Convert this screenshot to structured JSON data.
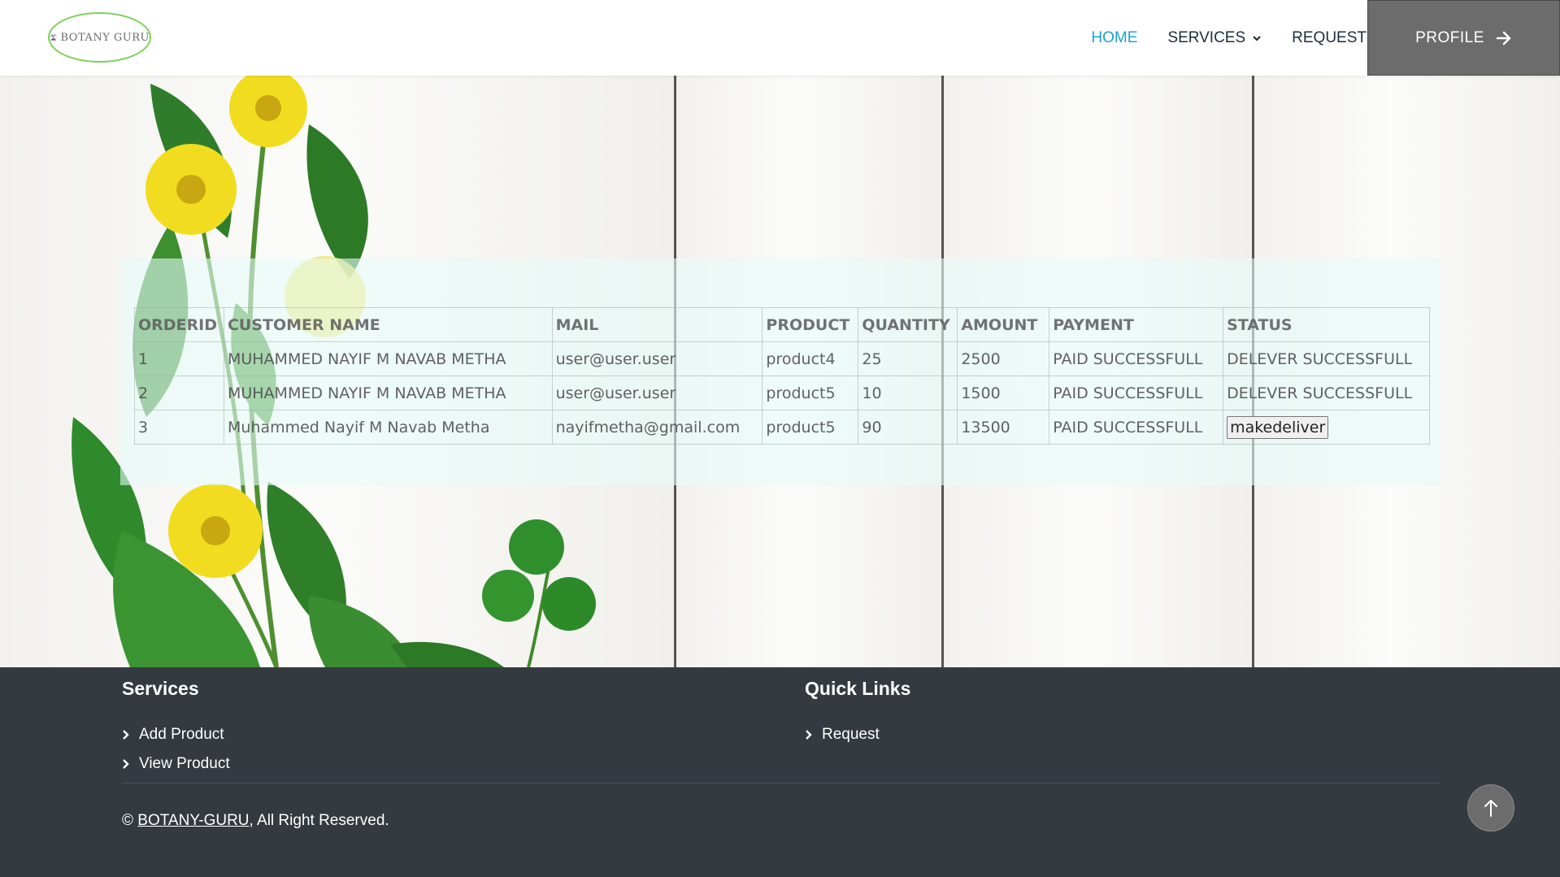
{
  "brand": {
    "logo_text": "BOTANY GURU"
  },
  "nav": {
    "home": "HOME",
    "services": "SERVICES",
    "request": "REQUEST",
    "profile": "PROFILE"
  },
  "colors": {
    "accent": "#1ea1d6",
    "profile_bg": "#6c6c6c",
    "footer_bg": "#343a40",
    "panel_bg": "#e6fcf9"
  },
  "orders": {
    "headers": [
      "ORDERID",
      "CUSTOMER NAME",
      "MAIL",
      "PRODUCT",
      "QUANTITY",
      "AMOUNT",
      "PAYMENT",
      "STATUS"
    ],
    "rows": [
      {
        "id": "1",
        "name": "MUHAMMED NAYIF M NAVAB METHA",
        "mail": "user@user.user",
        "product": "product4",
        "quantity": "25",
        "amount": "2500",
        "payment": "PAID SUCCESSFULL",
        "status": "DELEVER SUCCESSFULL"
      },
      {
        "id": "2",
        "name": "MUHAMMED NAYIF M NAVAB METHA",
        "mail": "user@user.user",
        "product": "product5",
        "quantity": "10",
        "amount": "1500",
        "payment": "PAID SUCCESSFULL",
        "status": "DELEVER SUCCESSFULL"
      },
      {
        "id": "3",
        "name": "Muhammed Nayif M Navab Metha",
        "mail": "nayifmetha@gmail.com",
        "product": "product5",
        "quantity": "90",
        "amount": "13500",
        "payment": "PAID SUCCESSFULL",
        "status_button": "makedeliver"
      }
    ]
  },
  "footer": {
    "services_title": "Services",
    "services_links": [
      "Add Product",
      "View Product"
    ],
    "quick_title": "Quick Links",
    "quick_links": [
      "Request"
    ],
    "copyright_prefix": "©",
    "copyright_link": "BOTANY-GURU",
    "copyright_suffix": ", All Right Reserved.",
    "back_to_top_icon": "arrow-up-icon"
  }
}
